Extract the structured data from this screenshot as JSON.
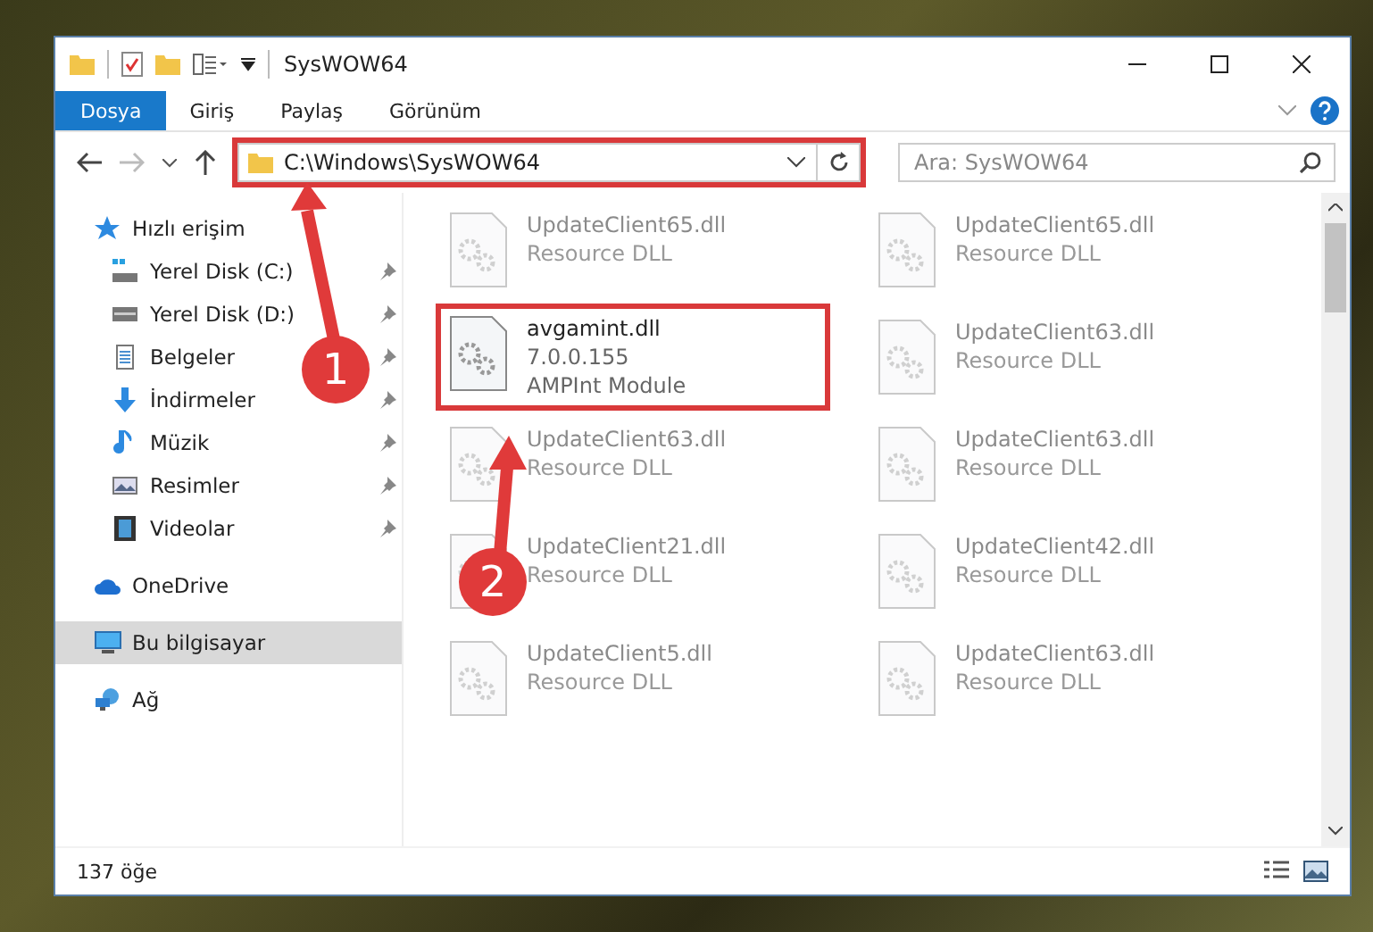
{
  "window": {
    "title": "SysWOW64"
  },
  "ribbon_tabs": [
    {
      "label": "Dosya",
      "selected": true
    },
    {
      "label": "Giriş",
      "selected": false
    },
    {
      "label": "Paylaş",
      "selected": false
    },
    {
      "label": "Görünüm",
      "selected": false
    }
  ],
  "address_bar": {
    "path": "C:\\Windows\\SysWOW64",
    "highlighted": true
  },
  "search": {
    "placeholder": "Ara: SysWOW64"
  },
  "sidebar": {
    "items": [
      {
        "label": "Hızlı erişim",
        "kind": "star",
        "pinned": false,
        "selected": false,
        "children": [
          {
            "label": "Yerel Disk (C:)",
            "kind": "systemdrive",
            "pinned": true,
            "selected": false
          },
          {
            "label": "Yerel Disk (D:)",
            "kind": "drive",
            "pinned": true,
            "selected": false
          },
          {
            "label": "Belgeler",
            "kind": "documents",
            "pinned": true,
            "selected": false
          },
          {
            "label": "İndirmeler",
            "kind": "downloads",
            "pinned": true,
            "selected": false
          },
          {
            "label": "Müzik",
            "kind": "music",
            "pinned": true,
            "selected": false
          },
          {
            "label": "Resimler",
            "kind": "pictures",
            "pinned": true,
            "selected": false
          },
          {
            "label": "Videolar",
            "kind": "videos",
            "pinned": true,
            "selected": false
          }
        ]
      },
      {
        "label": "OneDrive",
        "kind": "cloud",
        "pinned": false,
        "selected": false
      },
      {
        "label": "Bu bilgisayar",
        "kind": "computer",
        "pinned": false,
        "selected": true
      },
      {
        "label": "Ağ",
        "kind": "network",
        "pinned": false,
        "selected": false
      }
    ]
  },
  "files": [
    {
      "name": "UpdateClient65.dll",
      "lines": [
        "Resource DLL"
      ],
      "faded": true,
      "highlighted": false
    },
    {
      "name": "UpdateClient65.dll",
      "lines": [
        "Resource DLL"
      ],
      "faded": true,
      "highlighted": false
    },
    {
      "name": "avgamint.dll",
      "lines": [
        "7.0.0.155",
        "AMPInt Module"
      ],
      "faded": false,
      "highlighted": true
    },
    {
      "name": "UpdateClient63.dll",
      "lines": [
        "Resource DLL"
      ],
      "faded": true,
      "highlighted": false
    },
    {
      "name": "UpdateClient63.dll",
      "lines": [
        "Resource DLL"
      ],
      "faded": true,
      "highlighted": false
    },
    {
      "name": "UpdateClient63.dll",
      "lines": [
        "Resource DLL"
      ],
      "faded": true,
      "highlighted": false
    },
    {
      "name": "UpdateClient21.dll",
      "lines": [
        "Resource DLL"
      ],
      "faded": true,
      "highlighted": false
    },
    {
      "name": "UpdateClient42.dll",
      "lines": [
        "Resource DLL"
      ],
      "faded": true,
      "highlighted": false
    },
    {
      "name": "UpdateClient5.dll",
      "lines": [
        "Resource DLL"
      ],
      "faded": true,
      "highlighted": false
    },
    {
      "name": "UpdateClient63.dll",
      "lines": [
        "Resource DLL"
      ],
      "faded": true,
      "highlighted": false
    }
  ],
  "status_bar": {
    "count": "137 öğe"
  },
  "annotations": [
    {
      "number": "1"
    },
    {
      "number": "2"
    }
  ]
}
